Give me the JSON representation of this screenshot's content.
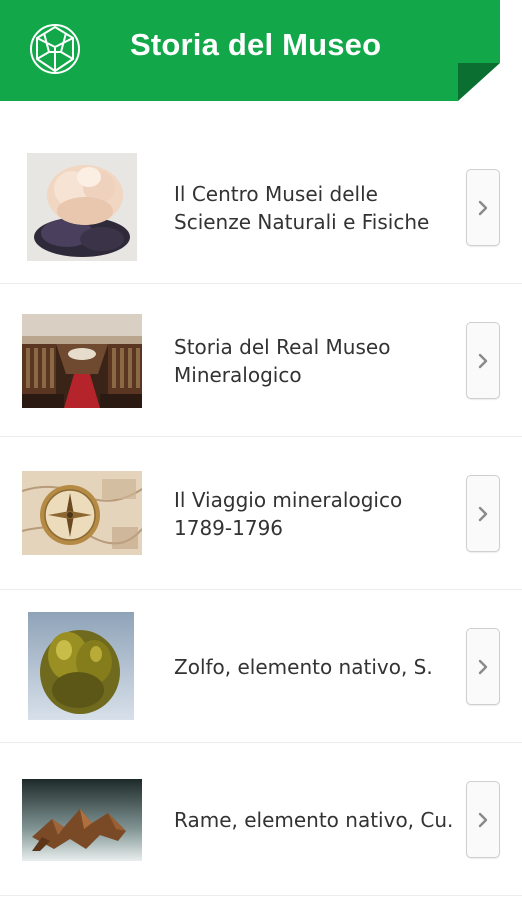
{
  "header": {
    "title": "Storia del Museo",
    "logo_icon": "crystal-icon",
    "background_color": "#12a84a"
  },
  "items": [
    {
      "label": "Il Centro Musei delle Scienze Naturali e Fisiche",
      "image": "white-crystal-mineral-photo",
      "chevron_icon": "chevron-right-icon"
    },
    {
      "label": "Storia del Real Museo Mineralogico",
      "image": "museum-hall-photo",
      "chevron_icon": "chevron-right-icon"
    },
    {
      "label": "Il Viaggio mineralogico 1789-1796",
      "image": "compass-map-photo",
      "chevron_icon": "chevron-right-icon"
    },
    {
      "label": "Zolfo, elemento nativo, S.",
      "image": "sulfur-crystal-photo",
      "chevron_icon": "chevron-right-icon"
    },
    {
      "label": "Rame, elemento nativo, Cu.",
      "image": "copper-mineral-photo",
      "chevron_icon": "chevron-right-icon"
    }
  ]
}
